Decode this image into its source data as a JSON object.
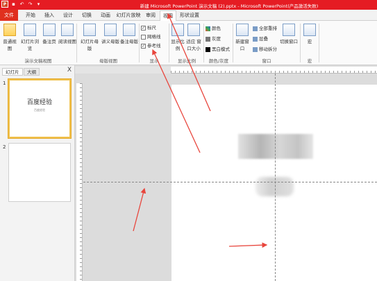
{
  "window": {
    "title": "新建 Microsoft PowerPoint 演示文稿 (2).pptx - Microsoft PowerPoint(产品激活失败)",
    "app_icon": "P",
    "qat": [
      "save",
      "undo",
      "redo",
      "customize"
    ]
  },
  "tabs": [
    "文件",
    "开始",
    "插入",
    "设计",
    "切换",
    "动画",
    "幻灯片放映",
    "审阅",
    "视图",
    "形状设置"
  ],
  "active_tab": "视图",
  "ribbon": {
    "groups": {
      "presentation_views": "演示文稿视图",
      "master_views": "母版视图",
      "show": "显示",
      "zoom": "显示比例",
      "color": "颜色/灰度",
      "window": "窗口",
      "macros": "宏"
    },
    "buttons": {
      "normal": "普通视图",
      "slide_sorter": "幻灯片浏览",
      "notes_page": "备注页",
      "reading_view": "阅读视图",
      "slide_master": "幻灯片母版",
      "handout_master": "讲义母版",
      "notes_master": "备注母版",
      "zoom": "显示比例",
      "fit_window": "适应\n窗口大小",
      "color": "颜色",
      "grayscale": "灰度",
      "bw": "黑白模式",
      "new_window": "新建窗口",
      "arrange_all": "全部重排",
      "cascade": "层叠",
      "move_split": "移动拆分",
      "switch_window": "切换窗口",
      "macros": "宏"
    },
    "checkboxes": {
      "ruler": {
        "label": "标尺",
        "checked": true
      },
      "gridlines": {
        "label": "网格线",
        "checked": false
      },
      "guides": {
        "label": "参考线",
        "checked": true
      }
    }
  },
  "left_panel": {
    "tab_slides": "幻灯片",
    "tab_outline": "大纲",
    "close": "X",
    "slides": [
      {
        "num": "1",
        "title": "百度经验",
        "subtitle": "百度经验"
      },
      {
        "num": "2",
        "title": "",
        "subtitle": ""
      }
    ]
  },
  "colors": {
    "title_bar": "#e51c23",
    "file_tab": "#e0301e",
    "accent_arrow": "#e8453c"
  }
}
